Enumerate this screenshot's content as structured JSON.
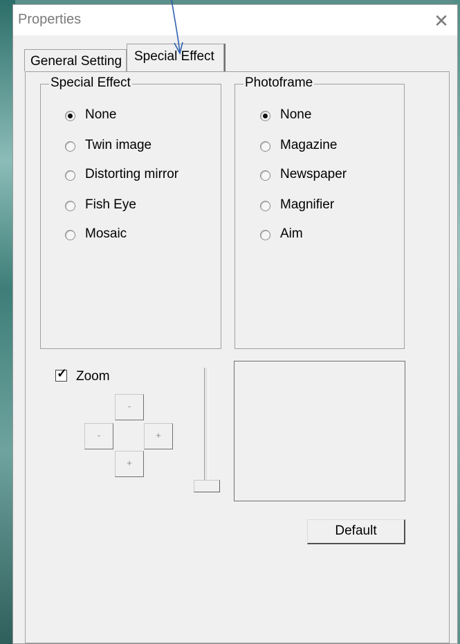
{
  "window": {
    "title": "Properties",
    "close_glyph": "✕"
  },
  "tabs": [
    {
      "label": "General Setting",
      "selected": false
    },
    {
      "label": "Special Effect",
      "selected": true
    }
  ],
  "special_effect_group": {
    "legend": "Special Effect",
    "options": [
      {
        "label": "None",
        "checked": true
      },
      {
        "label": "Twin image",
        "checked": false
      },
      {
        "label": "Distorting mirror",
        "checked": false
      },
      {
        "label": "Fish Eye",
        "checked": false
      },
      {
        "label": "Mosaic",
        "checked": false
      }
    ]
  },
  "photoframe_group": {
    "legend": "Photoframe",
    "options": [
      {
        "label": "None",
        "checked": true
      },
      {
        "label": "Magazine",
        "checked": false
      },
      {
        "label": "Newspaper",
        "checked": false
      },
      {
        "label": "Magnifier",
        "checked": false
      },
      {
        "label": "Aim",
        "checked": false
      }
    ]
  },
  "zoom": {
    "label": "Zoom",
    "checked": true,
    "check_glyph": "✓",
    "pad": {
      "up": "-",
      "left": "-",
      "right": "+",
      "down": "+"
    },
    "slider_level": 0
  },
  "default_button": {
    "label": "Default"
  },
  "colors": {
    "dialog_bg": "#f0f0f0",
    "titlebar_bg": "#ffffff",
    "title_text": "#7a7a7a",
    "annotation_arrow": "#2f5fb0"
  }
}
